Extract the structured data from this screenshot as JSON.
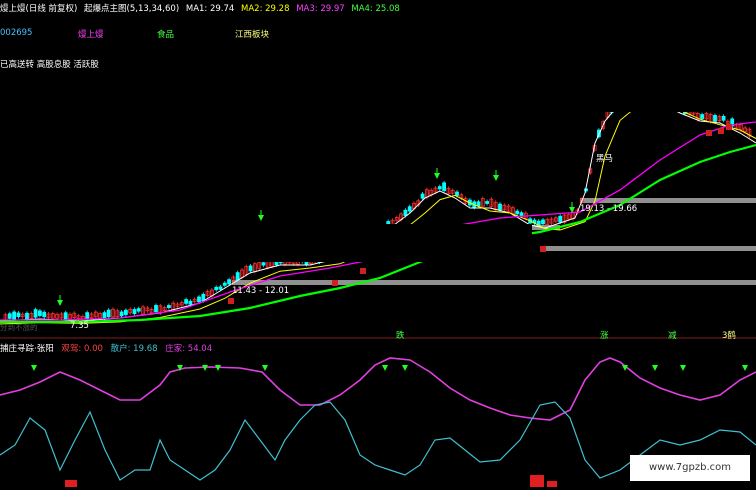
{
  "header": {
    "title": "熳上熳(日线 前复权)",
    "indicator": "起爆点主图(5,13,34,60)",
    "ma1": "MA1: 29.74",
    "ma2": "MA2: 29.28",
    "ma3": "MA3: 29.97",
    "ma4": "MA4: 25.08"
  },
  "info": {
    "code": "002695",
    "name": "熳上熳",
    "industry": "食品",
    "region": "江西板块",
    "tags": "已高送转 高股息股 活跃股"
  },
  "annotations": {
    "range1": "11.43 - 12.01",
    "range2": "19.13 - 19.66",
    "dark_horse": "黑马",
    "price_low": "7.35",
    "small_note": "分到不涨的"
  },
  "signals": {
    "s1": "跌",
    "s2": "涨",
    "s3": "减",
    "s4": "3鹤"
  },
  "subindicator": {
    "name": "捕庄寻踪·张阳",
    "watch": "观驾: 0.00",
    "retail": "散户: 19.68",
    "dealer": "庄家: 54.04"
  },
  "watermark": "www.7gpzb.com",
  "colors": {
    "ma1": "#ffffff",
    "ma2": "#ffff00",
    "ma3": "#ff00ff",
    "ma4": "#00ff00",
    "up": "#ff3030",
    "down": "#00ffff",
    "dealer_line": "#e040e0",
    "retail_line": "#40c0d0"
  }
}
